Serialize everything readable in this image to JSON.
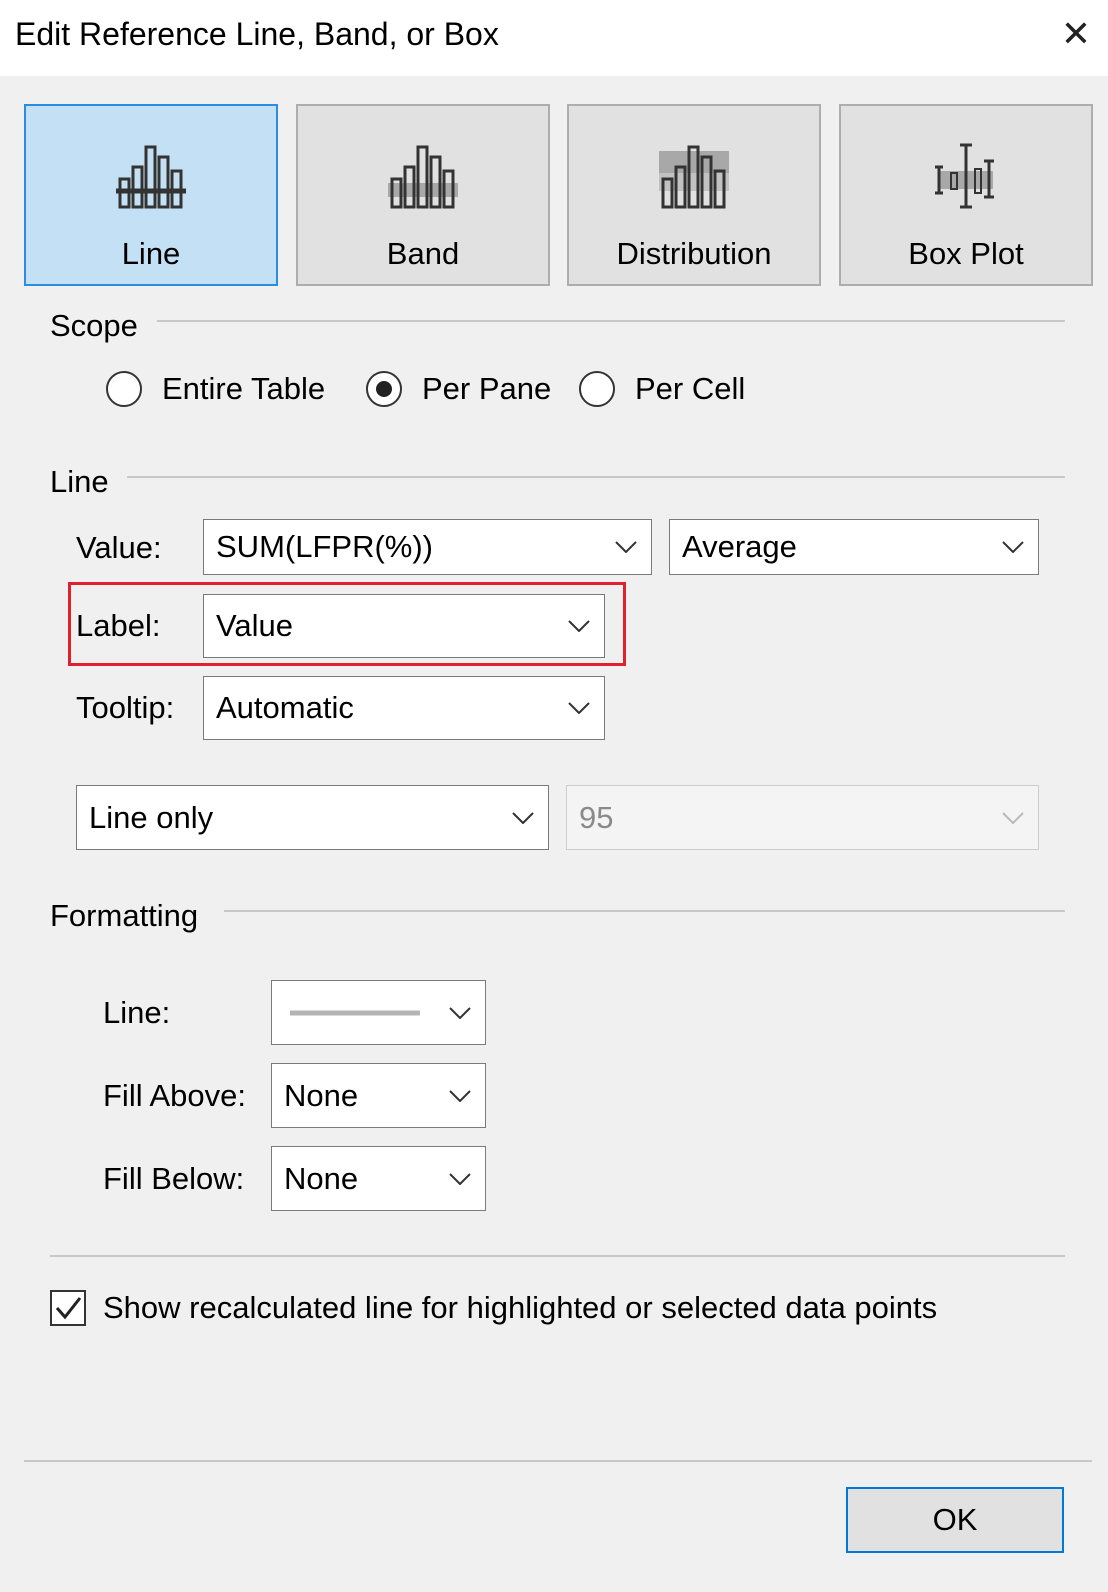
{
  "dialog": {
    "title": "Edit Reference Line, Band, or Box"
  },
  "type_buttons": [
    {
      "label": "Line",
      "icon": "reference-line-icon",
      "selected": true
    },
    {
      "label": "Band",
      "icon": "reference-band-icon",
      "selected": false
    },
    {
      "label": "Distribution",
      "icon": "reference-distribution-icon",
      "selected": false
    },
    {
      "label": "Box Plot",
      "icon": "box-plot-icon",
      "selected": false
    }
  ],
  "scope": {
    "heading": "Scope",
    "options": [
      {
        "label": "Entire Table",
        "checked": false
      },
      {
        "label": "Per Pane",
        "checked": true
      },
      {
        "label": "Per Cell",
        "checked": false
      }
    ]
  },
  "line": {
    "heading": "Line",
    "value_label": "Value:",
    "value_field": "SUM(LFPR(%))",
    "aggregation": "Average",
    "label_label": "Label:",
    "label_value": "Value",
    "tooltip_label": "Tooltip:",
    "tooltip_value": "Automatic",
    "confidence_mode": "Line only",
    "confidence_level": "95"
  },
  "formatting": {
    "heading": "Formatting",
    "line_label": "Line:",
    "fill_above_label": "Fill Above:",
    "fill_above_value": "None",
    "fill_below_label": "Fill Below:",
    "fill_below_value": "None"
  },
  "recalc": {
    "label": "Show recalculated line for highlighted or selected data points",
    "checked": true
  },
  "buttons": {
    "ok": "OK"
  },
  "colors": {
    "highlight": "#e0202d",
    "selected_tile": "#c4e0f5",
    "selected_border": "#2b8ce0"
  }
}
